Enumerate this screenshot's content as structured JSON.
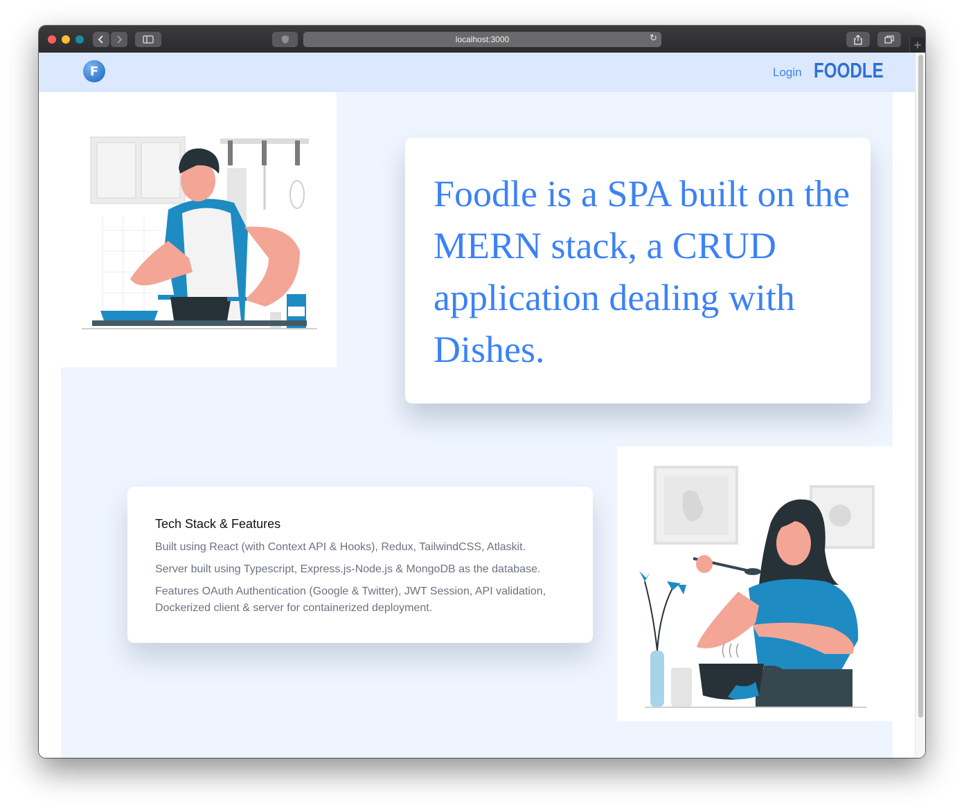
{
  "browser": {
    "url": "localhost:3000",
    "back_icon": "chevron-left-icon",
    "forward_icon": "chevron-right-icon",
    "sidebar_icon": "sidebar-icon",
    "shield_icon": "shield-icon",
    "reload_icon": "reload-icon",
    "share_icon": "share-icon",
    "tabs_icon": "tabs-icon",
    "new_tab_icon": "plus-icon"
  },
  "navbar": {
    "logo_letter": "F",
    "login_label": "Login",
    "brand": "FOODLE",
    "background": "#dbe8fd",
    "accent": "#3b82f6"
  },
  "hero": {
    "text": "Foodle is a SPA built on the MERN stack, a CRUD application dealing with Dishes.",
    "illustration": "man-cooking-illustration"
  },
  "features": {
    "title": "Tech Stack & Features",
    "lines": [
      "Built using React (with Context API & Hooks), Redux, TailwindCSS, Atlaskit.",
      "Server built using Typescript, Express.js-Node.js & MongoDB as the database.",
      "Features OAuth Authentication (Google & Twitter), JWT Session, API validation, Dockerized client & server for containerized deployment."
    ],
    "illustration": "woman-tasting-food-illustration"
  }
}
